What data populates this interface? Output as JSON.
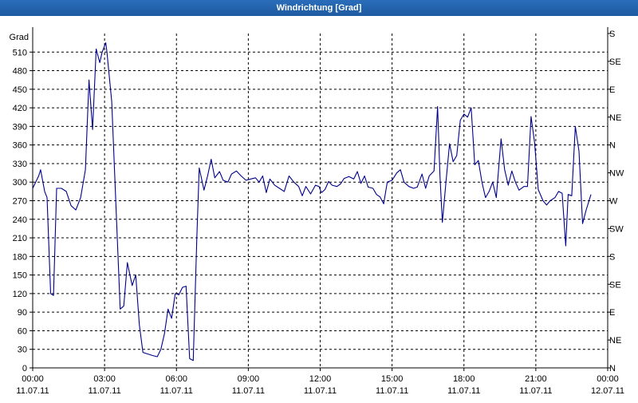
{
  "window": {
    "title": "Windrichtung [Grad]"
  },
  "chart_data": {
    "type": "line",
    "title": "Windrichtung [Grad]",
    "ylabel": "Grad",
    "xlabel": "",
    "ylim": [
      0,
      540
    ],
    "xlim": [
      0,
      24
    ],
    "y_ticks": [
      0,
      30,
      60,
      90,
      120,
      150,
      180,
      210,
      240,
      270,
      300,
      330,
      360,
      390,
      420,
      450,
      480,
      510
    ],
    "right_ticks": [
      {
        "value": 0,
        "label": "N"
      },
      {
        "value": 45,
        "label": "NE"
      },
      {
        "value": 90,
        "label": "E"
      },
      {
        "value": 135,
        "label": "SE"
      },
      {
        "value": 180,
        "label": "S"
      },
      {
        "value": 225,
        "label": "SW"
      },
      {
        "value": 270,
        "label": "W"
      },
      {
        "value": 315,
        "label": "NW"
      },
      {
        "value": 360,
        "label": "N"
      },
      {
        "value": 405,
        "label": "NE"
      },
      {
        "value": 450,
        "label": "E"
      },
      {
        "value": 495,
        "label": "SE"
      },
      {
        "value": 540,
        "label": "S"
      }
    ],
    "x_ticks": [
      {
        "value": 0,
        "time": "00:00",
        "date": "11.07.11"
      },
      {
        "value": 3,
        "time": "03:00",
        "date": "11.07.11"
      },
      {
        "value": 6,
        "time": "06:00",
        "date": "11.07.11"
      },
      {
        "value": 9,
        "time": "09:00",
        "date": "11.07.11"
      },
      {
        "value": 12,
        "time": "12:00",
        "date": "11.07.11"
      },
      {
        "value": 15,
        "time": "15:00",
        "date": "11.07.11"
      },
      {
        "value": 18,
        "time": "18:00",
        "date": "11.07.11"
      },
      {
        "value": 21,
        "time": "21:00",
        "date": "11.07.11"
      },
      {
        "value": 24,
        "time": "00:00",
        "date": "12.07.11"
      }
    ],
    "grid": true,
    "line_color": "#00008b",
    "series": [
      {
        "values": [
          [
            0.0,
            290
          ],
          [
            0.25,
            310
          ],
          [
            0.33,
            320
          ],
          [
            0.5,
            285
          ],
          [
            0.6,
            275
          ],
          [
            0.75,
            120
          ],
          [
            0.87,
            117
          ],
          [
            1.0,
            290
          ],
          [
            1.2,
            290
          ],
          [
            1.4,
            285
          ],
          [
            1.6,
            262
          ],
          [
            1.8,
            255
          ],
          [
            2.0,
            275
          ],
          [
            2.2,
            320
          ],
          [
            2.35,
            465
          ],
          [
            2.5,
            385
          ],
          [
            2.65,
            515
          ],
          [
            2.8,
            493
          ],
          [
            2.9,
            510
          ],
          [
            3.05,
            525
          ],
          [
            3.1,
            510
          ],
          [
            3.3,
            430
          ],
          [
            3.5,
            240
          ],
          [
            3.65,
            95
          ],
          [
            3.8,
            100
          ],
          [
            3.95,
            170
          ],
          [
            4.15,
            133
          ],
          [
            4.3,
            150
          ],
          [
            4.45,
            70
          ],
          [
            4.6,
            25
          ],
          [
            5.0,
            20
          ],
          [
            5.2,
            18
          ],
          [
            5.35,
            30
          ],
          [
            5.5,
            55
          ],
          [
            5.65,
            95
          ],
          [
            5.8,
            80
          ],
          [
            5.95,
            120
          ],
          [
            6.1,
            118
          ],
          [
            6.25,
            130
          ],
          [
            6.4,
            132
          ],
          [
            6.55,
            15
          ],
          [
            6.7,
            12
          ],
          [
            6.85,
            210
          ],
          [
            6.95,
            323
          ],
          [
            7.15,
            287
          ],
          [
            7.3,
            310
          ],
          [
            7.45,
            337
          ],
          [
            7.6,
            307
          ],
          [
            7.8,
            317
          ],
          [
            7.95,
            303
          ],
          [
            8.15,
            300
          ],
          [
            8.3,
            313
          ],
          [
            8.5,
            318
          ],
          [
            8.7,
            310
          ],
          [
            8.9,
            303
          ],
          [
            9.1,
            305
          ],
          [
            9.3,
            307
          ],
          [
            9.45,
            300
          ],
          [
            9.6,
            310
          ],
          [
            9.75,
            283
          ],
          [
            9.9,
            305
          ],
          [
            10.1,
            295
          ],
          [
            10.3,
            290
          ],
          [
            10.5,
            285
          ],
          [
            10.7,
            310
          ],
          [
            10.9,
            300
          ],
          [
            11.1,
            293
          ],
          [
            11.25,
            278
          ],
          [
            11.4,
            293
          ],
          [
            11.6,
            281
          ],
          [
            11.8,
            295
          ],
          [
            11.95,
            293
          ],
          [
            12.05,
            283
          ],
          [
            12.2,
            288
          ],
          [
            12.35,
            301
          ],
          [
            12.5,
            295
          ],
          [
            12.7,
            293
          ],
          [
            12.85,
            297
          ],
          [
            13.0,
            306
          ],
          [
            13.2,
            309
          ],
          [
            13.4,
            305
          ],
          [
            13.55,
            317
          ],
          [
            13.7,
            298
          ],
          [
            13.85,
            310
          ],
          [
            14.0,
            292
          ],
          [
            14.2,
            290
          ],
          [
            14.35,
            280
          ],
          [
            14.5,
            276
          ],
          [
            14.65,
            265
          ],
          [
            14.8,
            300
          ],
          [
            15.0,
            303
          ],
          [
            15.2,
            315
          ],
          [
            15.35,
            320
          ],
          [
            15.5,
            300
          ],
          [
            15.7,
            293
          ],
          [
            15.9,
            290
          ],
          [
            16.05,
            292
          ],
          [
            16.25,
            313
          ],
          [
            16.4,
            290
          ],
          [
            16.55,
            310
          ],
          [
            16.75,
            318
          ],
          [
            16.9,
            422
          ],
          [
            17.0,
            310
          ],
          [
            17.1,
            235
          ],
          [
            17.25,
            300
          ],
          [
            17.4,
            362
          ],
          [
            17.55,
            333
          ],
          [
            17.7,
            343
          ],
          [
            17.85,
            400
          ],
          [
            18.0,
            410
          ],
          [
            18.15,
            405
          ],
          [
            18.3,
            420
          ],
          [
            18.45,
            328
          ],
          [
            18.6,
            335
          ],
          [
            18.75,
            300
          ],
          [
            18.9,
            275
          ],
          [
            19.05,
            285
          ],
          [
            19.2,
            300
          ],
          [
            19.35,
            275
          ],
          [
            19.55,
            370
          ],
          [
            19.7,
            320
          ],
          [
            19.85,
            295
          ],
          [
            20.0,
            318
          ],
          [
            20.15,
            300
          ],
          [
            20.3,
            287
          ],
          [
            20.5,
            293
          ],
          [
            20.65,
            293
          ],
          [
            20.8,
            406
          ],
          [
            20.95,
            363
          ],
          [
            21.1,
            288
          ],
          [
            21.3,
            270
          ],
          [
            21.45,
            263
          ],
          [
            21.6,
            270
          ],
          [
            21.8,
            275
          ],
          [
            21.95,
            285
          ],
          [
            22.1,
            282
          ],
          [
            22.25,
            197
          ],
          [
            22.35,
            280
          ],
          [
            22.5,
            278
          ],
          [
            22.65,
            390
          ],
          [
            22.8,
            350
          ],
          [
            22.95,
            233
          ],
          [
            23.1,
            255
          ],
          [
            23.3,
            280
          ]
        ]
      }
    ]
  }
}
